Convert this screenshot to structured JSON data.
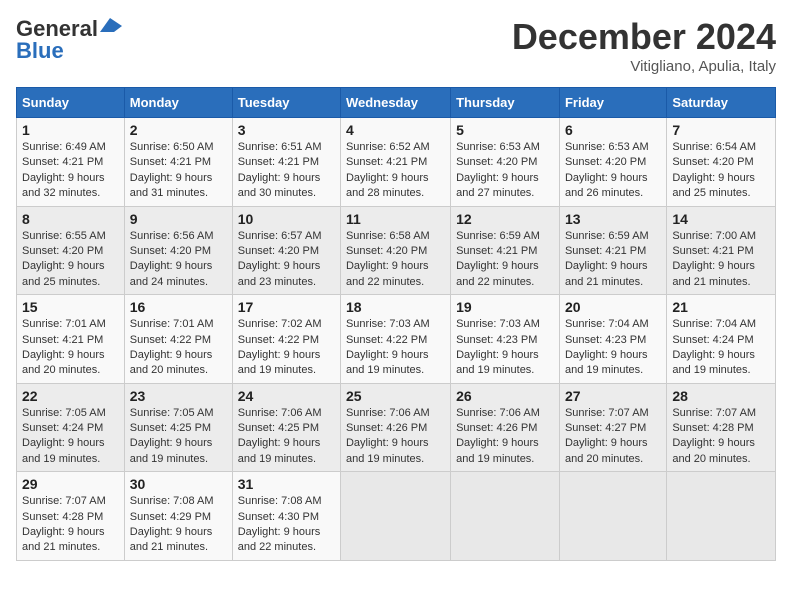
{
  "header": {
    "logo_line1": "General",
    "logo_line2": "Blue",
    "month": "December 2024",
    "location": "Vitigliano, Apulia, Italy"
  },
  "days_of_week": [
    "Sunday",
    "Monday",
    "Tuesday",
    "Wednesday",
    "Thursday",
    "Friday",
    "Saturday"
  ],
  "weeks": [
    [
      {
        "day": 1,
        "sunrise": "6:49 AM",
        "sunset": "4:21 PM",
        "daylight": "9 hours and 32 minutes."
      },
      {
        "day": 2,
        "sunrise": "6:50 AM",
        "sunset": "4:21 PM",
        "daylight": "9 hours and 31 minutes."
      },
      {
        "day": 3,
        "sunrise": "6:51 AM",
        "sunset": "4:21 PM",
        "daylight": "9 hours and 30 minutes."
      },
      {
        "day": 4,
        "sunrise": "6:52 AM",
        "sunset": "4:21 PM",
        "daylight": "9 hours and 28 minutes."
      },
      {
        "day": 5,
        "sunrise": "6:53 AM",
        "sunset": "4:20 PM",
        "daylight": "9 hours and 27 minutes."
      },
      {
        "day": 6,
        "sunrise": "6:53 AM",
        "sunset": "4:20 PM",
        "daylight": "9 hours and 26 minutes."
      },
      {
        "day": 7,
        "sunrise": "6:54 AM",
        "sunset": "4:20 PM",
        "daylight": "9 hours and 25 minutes."
      }
    ],
    [
      {
        "day": 8,
        "sunrise": "6:55 AM",
        "sunset": "4:20 PM",
        "daylight": "9 hours and 25 minutes."
      },
      {
        "day": 9,
        "sunrise": "6:56 AM",
        "sunset": "4:20 PM",
        "daylight": "9 hours and 24 minutes."
      },
      {
        "day": 10,
        "sunrise": "6:57 AM",
        "sunset": "4:20 PM",
        "daylight": "9 hours and 23 minutes."
      },
      {
        "day": 11,
        "sunrise": "6:58 AM",
        "sunset": "4:20 PM",
        "daylight": "9 hours and 22 minutes."
      },
      {
        "day": 12,
        "sunrise": "6:59 AM",
        "sunset": "4:21 PM",
        "daylight": "9 hours and 22 minutes."
      },
      {
        "day": 13,
        "sunrise": "6:59 AM",
        "sunset": "4:21 PM",
        "daylight": "9 hours and 21 minutes."
      },
      {
        "day": 14,
        "sunrise": "7:00 AM",
        "sunset": "4:21 PM",
        "daylight": "9 hours and 21 minutes."
      }
    ],
    [
      {
        "day": 15,
        "sunrise": "7:01 AM",
        "sunset": "4:21 PM",
        "daylight": "9 hours and 20 minutes."
      },
      {
        "day": 16,
        "sunrise": "7:01 AM",
        "sunset": "4:22 PM",
        "daylight": "9 hours and 20 minutes."
      },
      {
        "day": 17,
        "sunrise": "7:02 AM",
        "sunset": "4:22 PM",
        "daylight": "9 hours and 19 minutes."
      },
      {
        "day": 18,
        "sunrise": "7:03 AM",
        "sunset": "4:22 PM",
        "daylight": "9 hours and 19 minutes."
      },
      {
        "day": 19,
        "sunrise": "7:03 AM",
        "sunset": "4:23 PM",
        "daylight": "9 hours and 19 minutes."
      },
      {
        "day": 20,
        "sunrise": "7:04 AM",
        "sunset": "4:23 PM",
        "daylight": "9 hours and 19 minutes."
      },
      {
        "day": 21,
        "sunrise": "7:04 AM",
        "sunset": "4:24 PM",
        "daylight": "9 hours and 19 minutes."
      }
    ],
    [
      {
        "day": 22,
        "sunrise": "7:05 AM",
        "sunset": "4:24 PM",
        "daylight": "9 hours and 19 minutes."
      },
      {
        "day": 23,
        "sunrise": "7:05 AM",
        "sunset": "4:25 PM",
        "daylight": "9 hours and 19 minutes."
      },
      {
        "day": 24,
        "sunrise": "7:06 AM",
        "sunset": "4:25 PM",
        "daylight": "9 hours and 19 minutes."
      },
      {
        "day": 25,
        "sunrise": "7:06 AM",
        "sunset": "4:26 PM",
        "daylight": "9 hours and 19 minutes."
      },
      {
        "day": 26,
        "sunrise": "7:06 AM",
        "sunset": "4:26 PM",
        "daylight": "9 hours and 19 minutes."
      },
      {
        "day": 27,
        "sunrise": "7:07 AM",
        "sunset": "4:27 PM",
        "daylight": "9 hours and 20 minutes."
      },
      {
        "day": 28,
        "sunrise": "7:07 AM",
        "sunset": "4:28 PM",
        "daylight": "9 hours and 20 minutes."
      }
    ],
    [
      {
        "day": 29,
        "sunrise": "7:07 AM",
        "sunset": "4:28 PM",
        "daylight": "9 hours and 21 minutes."
      },
      {
        "day": 30,
        "sunrise": "7:08 AM",
        "sunset": "4:29 PM",
        "daylight": "9 hours and 21 minutes."
      },
      {
        "day": 31,
        "sunrise": "7:08 AM",
        "sunset": "4:30 PM",
        "daylight": "9 hours and 22 minutes."
      },
      null,
      null,
      null,
      null
    ]
  ]
}
